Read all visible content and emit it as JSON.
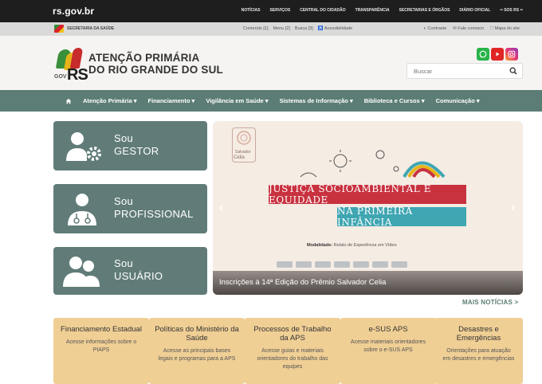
{
  "topbar": {
    "brand": "rs.gov.br",
    "links": [
      "NOTÍCIAS",
      "SERVIÇOS",
      "CENTRAL DO CIDADÃO",
      "TRANSPARÊNCIA",
      "SECRETARIAS E ÓRGÃOS",
      "DIÁRIO OFICIAL",
      "•• SOS RS ••"
    ]
  },
  "secbar": {
    "secretaria": "SECRETARIA DA SAÚDE",
    "accessibility": [
      "Conteúdo [1]",
      "Menu [2]",
      "Busca [3]",
      "♿ Acessibilidade"
    ],
    "right": [
      "◐ Contraste",
      "✉ Fale conosco",
      "⛶ Mapa do site"
    ]
  },
  "header": {
    "logo_gov": "GOV",
    "logo_rs": "RS",
    "title_line1": "ATENÇÃO PRIMÁRIA",
    "title_line2": "DO RIO GRANDE DO SUL",
    "search_placeholder": "Buscar"
  },
  "nav": {
    "home_icon": "home-icon",
    "items": [
      "Atenção Primária ▾",
      "Financiamento ▾",
      "Vigilância em Saúde ▾",
      "Sistemas de Informação ▾",
      "Biblioteca e Cursos ▾",
      "Comunicação ▾"
    ]
  },
  "cards": [
    {
      "line1": "Sou",
      "line2": "GESTOR",
      "icon": "user-gear-icon"
    },
    {
      "line1": "Sou",
      "line2": "PROFISSIONAL",
      "icon": "doctor-icon"
    },
    {
      "line1": "Sou",
      "line2": "USUÁRIO",
      "icon": "users-icon"
    }
  ],
  "banner": {
    "stamp_line1": "Salvador",
    "stamp_line2": "Celia",
    "headline_1": "JUSTIÇA SOCIOAMBIENTAL E EQUIDADE",
    "headline_2": "NA PRIMEIRA INFÂNCIA",
    "modality_label": "Modalidade:",
    "modality_value": "Relato de Experiência em Vídeo",
    "caption": "Inscrições à 14ª Edição do Prêmio Salvador Celia",
    "prev": "‹",
    "next": "›"
  },
  "more_news": "MAIS NOTÍCIAS >",
  "bottom_cards": [
    {
      "title": "Financiamento Estadual",
      "desc": "Acesse informações sobre o PIAPS"
    },
    {
      "title": "Políticas do Ministério da Saúde",
      "desc": "Acesse as principais bases legais e programas para a APS"
    },
    {
      "title": "Processos de Trabalho da APS",
      "desc": "Acesse guias e materiais orientadores do trabalho das equipes"
    },
    {
      "title": "e-SUS APS",
      "desc": "Acesse materiais orientadores sobre o e-SUS APS"
    },
    {
      "title": "Desastres e Emergências",
      "desc": "Orientações para atuação em desastres e emergências"
    }
  ],
  "colors": {
    "nav": "#5c7d75",
    "card": "#617c78",
    "bottom_card": "#f0cf95",
    "ribbon_red": "#c8323f",
    "ribbon_teal": "#3fa6b2"
  }
}
